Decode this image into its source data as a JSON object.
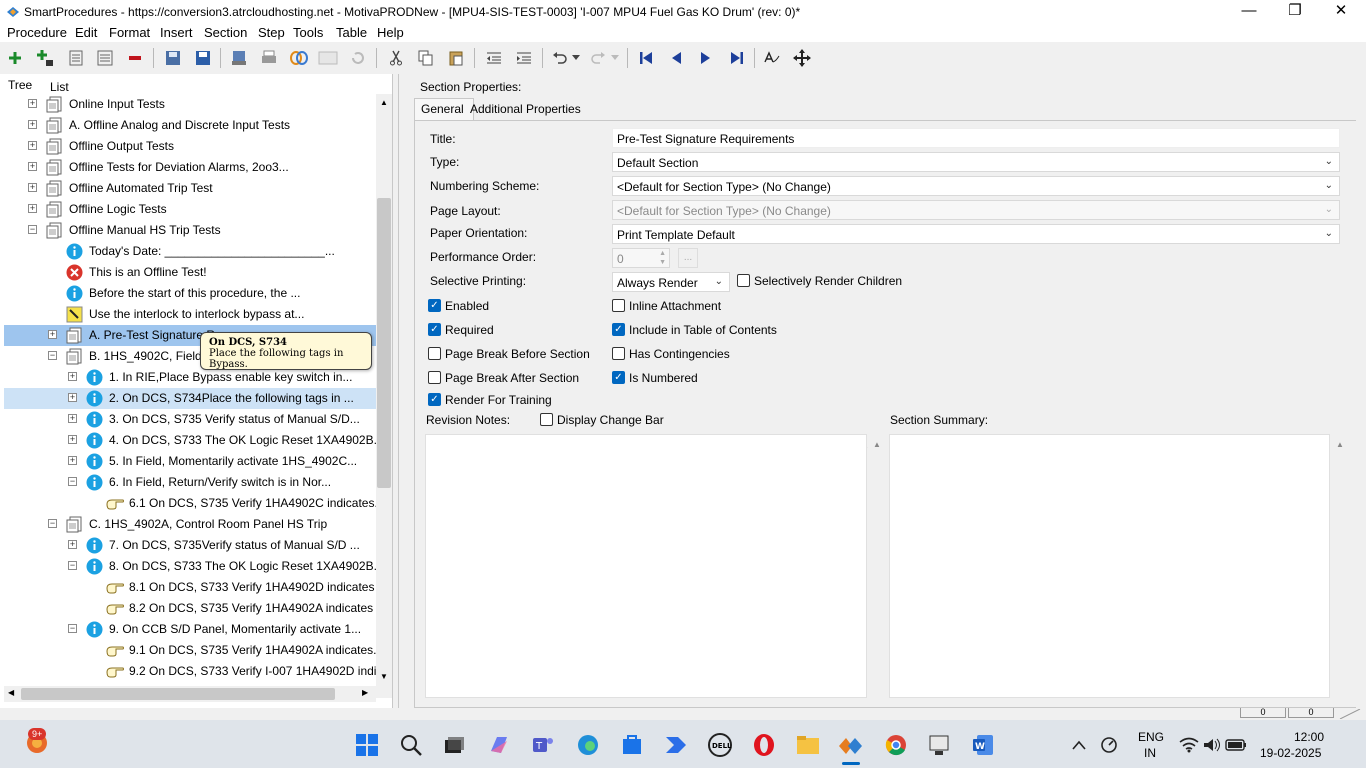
{
  "window": {
    "title": "SmartProcedures - https://conversion3.atrcloudhosting.net - MotivaPRODNew - [MPU4-SIS-TEST-0003] 'I-007 MPU4 Fuel Gas KO Drum' (rev: 0)*"
  },
  "menu": [
    "Procedure",
    "Edit",
    "Format",
    "Insert",
    "Section",
    "Step",
    "Tools",
    "Table",
    "Help"
  ],
  "left_tabs": [
    "Tree",
    "List"
  ],
  "tree": [
    {
      "label": "Online Input Tests",
      "icon": "section-icon",
      "expander": "+"
    },
    {
      "label": "A. Offline Analog and Discrete Input Tests",
      "icon": "section-icon",
      "expander": "+"
    },
    {
      "label": "Offline Output Tests",
      "icon": "section-icon",
      "expander": "+"
    },
    {
      "label": "Offline Tests for Deviation Alarms, 2oo3...",
      "icon": "section-icon",
      "expander": "+"
    },
    {
      "label": "Offline Automated Trip Test",
      "icon": "section-icon",
      "expander": "+"
    },
    {
      "label": "Offline Logic Tests",
      "icon": "section-icon",
      "expander": "+"
    },
    {
      "label": "Offline Manual HS Trip Tests",
      "icon": "section-icon",
      "expander": "-"
    },
    {
      "label": "Today's Date: ________________________...",
      "icon": "info-icon",
      "expander": ""
    },
    {
      "label": "This is an Offline Test!",
      "icon": "error-icon",
      "expander": ""
    },
    {
      "label": "Before the start of this procedure, the ...",
      "icon": "info-icon",
      "expander": ""
    },
    {
      "label": "Use the interlock to interlock bypass at...",
      "icon": "warning-note-icon",
      "expander": ""
    },
    {
      "label": "A. Pre-Test Signature R...",
      "icon": "section-icon",
      "expander": "+"
    },
    {
      "label": "B. 1HS_4902C, Field HS...",
      "icon": "section-icon",
      "expander": "-"
    },
    {
      "label": "1. In RIE,Place Bypass enable key switch in...",
      "icon": "info-icon",
      "expander": "+"
    },
    {
      "label": "2. On DCS, S734Place the following tags in ...",
      "icon": "info-icon",
      "expander": "+"
    },
    {
      "label": "3. On DCS, S735 Verify status of Manual S/D...",
      "icon": "info-icon",
      "expander": "+"
    },
    {
      "label": "4. On DCS, S733 The OK Logic Reset 1XA4902B...",
      "icon": "info-icon",
      "expander": "+"
    },
    {
      "label": "5. In Field, Momentarily activate 1HS_4902C...",
      "icon": "info-icon",
      "expander": "+"
    },
    {
      "label": "6. In Field, Return/Verify switch is in Nor...",
      "icon": "info-icon",
      "expander": "-"
    },
    {
      "label": "6.1 On DCS, S735 Verify  1HA4902C indicates...",
      "icon": "hand-step-icon",
      "expander": ""
    },
    {
      "label": "C. 1HS_4902A, Control Room Panel HS Trip",
      "icon": "section-icon",
      "expander": "-"
    },
    {
      "label": "7. On DCS, S735Verify status of Manual S/D ...",
      "icon": "info-icon",
      "expander": "+"
    },
    {
      "label": "8. On DCS, S733 The OK Logic Reset 1XA4902B...",
      "icon": "info-icon",
      "expander": "-"
    },
    {
      "label": "8.1 On DCS, S733 Verify 1HA4902D  indicates ...",
      "icon": "hand-step-icon",
      "expander": ""
    },
    {
      "label": "8.2 On DCS, S735 Verify 1HA4902A  indicates ...",
      "icon": "hand-step-icon",
      "expander": ""
    },
    {
      "label": "9. On CCB S/D Panel, Momentarily activate 1...",
      "icon": "info-icon",
      "expander": "-"
    },
    {
      "label": "9.1 On DCS, S735 Verify  1HA4902A indicates...",
      "icon": "hand-step-icon",
      "expander": ""
    },
    {
      "label": "9.2 On DCS, S733 Verify I-007 1HA4902D indi...",
      "icon": "hand-step-icon",
      "expander": ""
    }
  ],
  "tooltip": {
    "title": "On DCS, S734",
    "body": "Place the following tags in Bypass."
  },
  "section": {
    "header": "Section Properties:",
    "tabs": [
      "General",
      "Additional Properties"
    ],
    "labels": {
      "title": "Title:",
      "type": "Type:",
      "numbering": "Numbering Scheme:",
      "layout": "Page Layout:",
      "orientation": "Paper Orientation:",
      "perf_order": "Performance Order:",
      "selective": "Selective Printing:"
    },
    "values": {
      "title": "Pre-Test Signature Requirements",
      "type": "Default Section",
      "numbering": "<Default for Section Type> (No Change)",
      "layout": "<Default for Section Type> (No Change)",
      "orientation": "Print Template Default",
      "perf_order": "0",
      "selective": "Always Render"
    },
    "checkboxes": {
      "selectively_render_children": {
        "label": "Selectively Render Children",
        "checked": false
      },
      "enabled": {
        "label": "Enabled",
        "checked": true
      },
      "inline_attachment": {
        "label": "Inline Attachment",
        "checked": false
      },
      "required": {
        "label": "Required",
        "checked": true
      },
      "include_toc": {
        "label": "Include in Table of Contents",
        "checked": true
      },
      "page_break_before": {
        "label": "Page Break Before Section",
        "checked": false
      },
      "has_contingencies": {
        "label": "Has Contingencies",
        "checked": false
      },
      "page_break_after": {
        "label": "Page Break After Section",
        "checked": false
      },
      "is_numbered": {
        "label": "Is Numbered",
        "checked": true
      },
      "render_training": {
        "label": "Render For Training",
        "checked": true
      },
      "display_change_bar": {
        "label": "Display Change Bar",
        "checked": false
      }
    },
    "revision_notes_label": "Revision Notes:",
    "summary_label": "Section Summary:"
  },
  "statusbar": {
    "left": "0",
    "right": "0"
  },
  "taskbar": {
    "badge": "9+",
    "lang": "ENG",
    "region": "IN",
    "time": "12:00",
    "date": "19-02-2025"
  },
  "colors": {
    "accent": "#0067c0",
    "selection": "#cde2f6",
    "selection_dark": "#9ec5ee",
    "info": "#1ba1e2",
    "error": "#d9342b"
  }
}
